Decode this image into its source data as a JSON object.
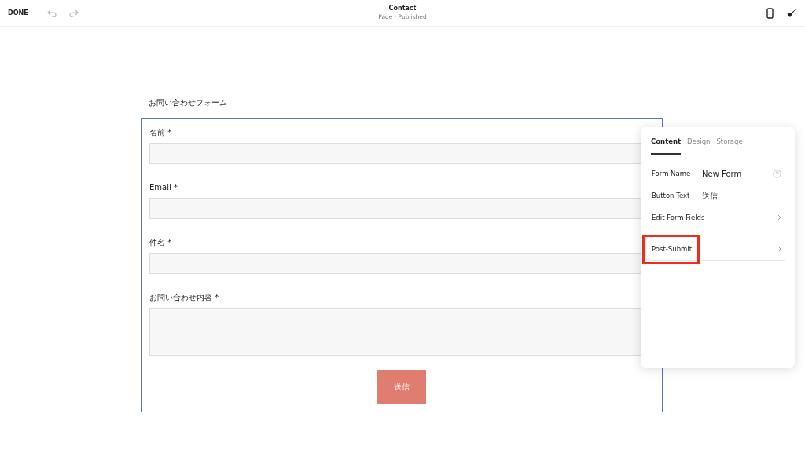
{
  "toolbar": {
    "done": "DONE",
    "title": "Contact",
    "subtitle": "Page · Published"
  },
  "form": {
    "heading": "お問い合わせフォーム",
    "fields": [
      {
        "label": "名前 *",
        "kind": "input"
      },
      {
        "label": "Email *",
        "kind": "input"
      },
      {
        "label": "件名 *",
        "kind": "input"
      },
      {
        "label": "お問い合わせ内容 *",
        "kind": "textarea"
      }
    ],
    "submit": "送信"
  },
  "panel": {
    "tabs": [
      {
        "label": "Content",
        "selected": true
      },
      {
        "label": "Design",
        "selected": false
      },
      {
        "label": "Storage",
        "selected": false
      }
    ],
    "rows": [
      {
        "kind": "value",
        "label": "Form Name",
        "value": "New Form",
        "help": true,
        "highlighted": false
      },
      {
        "kind": "value",
        "label": "Button Text",
        "value": "送信",
        "help": false,
        "highlighted": false
      },
      {
        "kind": "link",
        "label": "Edit Form Fields",
        "highlighted": false
      },
      {
        "kind": "link",
        "label": "Post-Submit",
        "highlighted": true
      }
    ]
  }
}
